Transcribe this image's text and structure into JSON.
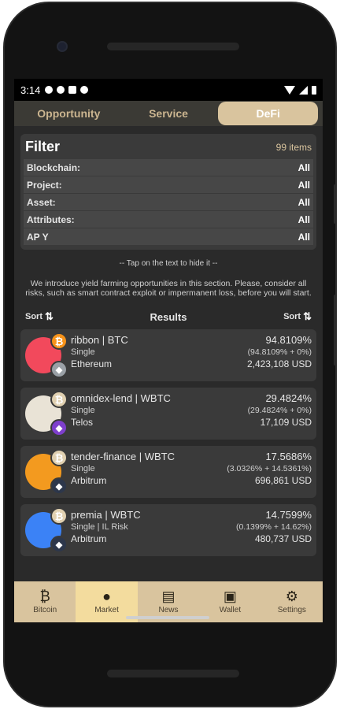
{
  "status_bar": {
    "time": "3:14",
    "icons": [
      "gear-icon",
      "shield-icon",
      "clipboard-icon",
      "globe-icon"
    ],
    "right_icons": [
      "wifi-icon",
      "signal-icon",
      "battery-icon"
    ]
  },
  "tabs": [
    {
      "label": "Opportunity",
      "active": false
    },
    {
      "label": "Service",
      "active": false
    },
    {
      "label": "DeFi",
      "active": true
    }
  ],
  "filter": {
    "title": "Filter",
    "count": "99 items",
    "rows": [
      {
        "label": "Blockchain:",
        "value": "All"
      },
      {
        "label": "Project:",
        "value": "All"
      },
      {
        "label": "Asset:",
        "value": "All"
      },
      {
        "label": "Attributes:",
        "value": "All"
      },
      {
        "label": "AP Y",
        "value": "All"
      }
    ]
  },
  "hint": "-- Tap on the text to hide it --",
  "intro": "We introduce yield farming opportunities in this section. Please, consider all risks, such as smart contract exploit or impermanent loss, before you will start.",
  "results": {
    "sort_left": "Sort",
    "sort_right": "Sort",
    "title": "Results",
    "cards": [
      {
        "name": "ribbon | BTC",
        "apy": "94.8109%",
        "type": "Single",
        "breakdown": "(94.8109% + 0%)",
        "chain": "Ethereum",
        "tvl": "2,423,108 USD",
        "logo_color": "#f2495c"
      },
      {
        "name": "omnidex-lend | WBTC",
        "apy": "29.4824%",
        "type": "Single",
        "breakdown": "(29.4824% + 0%)",
        "chain": "Telos",
        "tvl": "17,109 USD",
        "logo_color": "#e9e3d6"
      },
      {
        "name": "tender-finance | WBTC",
        "apy": "17.5686%",
        "type": "Single",
        "breakdown": "(3.0326% + 14.5361%)",
        "chain": "Arbitrum",
        "tvl": "696,861 USD",
        "logo_color": "#f39a1f"
      },
      {
        "name": "premia | WBTC",
        "apy": "14.7599%",
        "type": "Single | IL Risk",
        "breakdown": "(0.1399% + 14.62%)",
        "chain": "Arbitrum",
        "tvl": "480,737 USD",
        "logo_color": "#3b82f6"
      }
    ]
  },
  "bottom_nav": [
    {
      "label": "Bitcoin",
      "icon": "bitcoin-icon",
      "active": false
    },
    {
      "label": "Market",
      "icon": "market-icon",
      "active": true
    },
    {
      "label": "News",
      "icon": "news-icon",
      "active": false
    },
    {
      "label": "Wallet",
      "icon": "wallet-icon",
      "active": false
    },
    {
      "label": "Settings",
      "icon": "settings-icon",
      "active": false
    }
  ],
  "colors": {
    "accent": "#d9c49e",
    "background": "#2a2a2a",
    "card": "#3a3a3a",
    "bitcoin": "#f7931a"
  }
}
